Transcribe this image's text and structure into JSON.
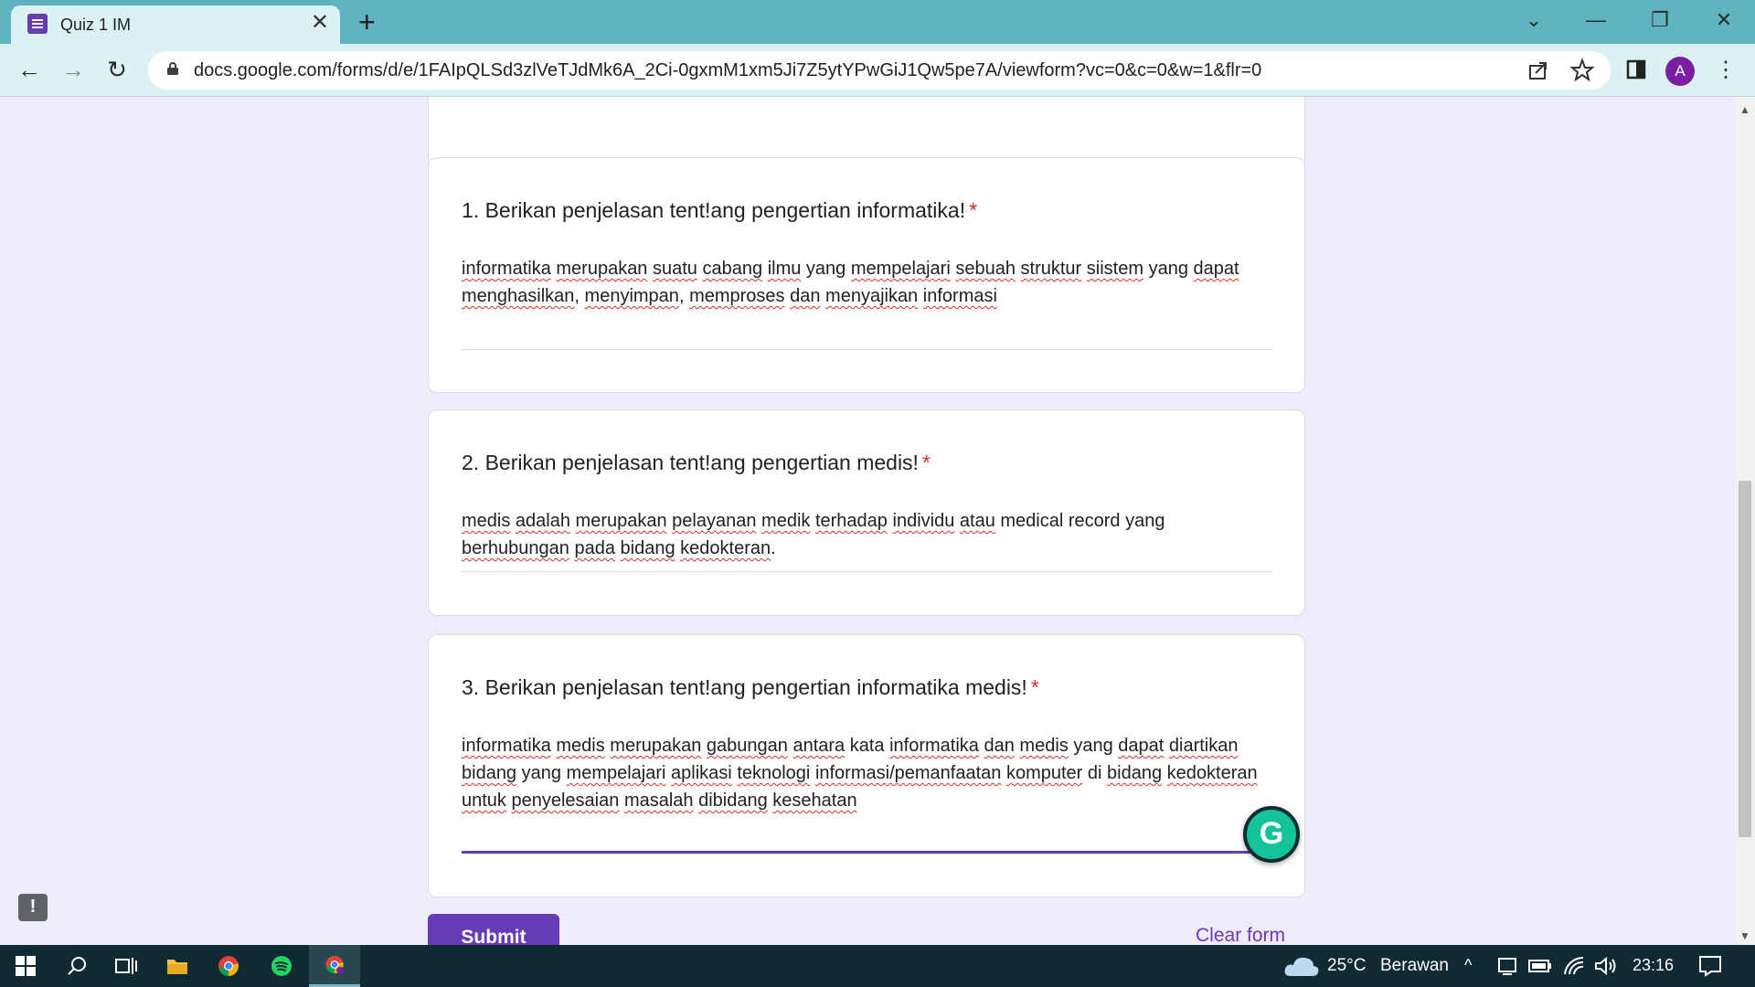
{
  "browser": {
    "tab": {
      "title": "Quiz 1 IM",
      "close": "✕"
    },
    "new_tab": "+",
    "window_controls": {
      "minimize": "—",
      "restore": "❐",
      "close": "✕",
      "tab_search": "⌄"
    },
    "nav": {
      "back": "←",
      "forward": "→",
      "reload": "↻"
    },
    "url": "docs.google.com/forms/d/e/1FAIpQLSd3zlVeTJdMk6A_2Ci-0gxmM1xm5Ji7Z5ytYPwGiJ1Qw5pe7A/viewform?vc=0&c=0&w=1&flr=0",
    "profile_initial": "A",
    "accent": "#5fb4bf"
  },
  "form": {
    "accent": "#673ab7",
    "required_mark": "*",
    "questions": [
      {
        "title": "1. Berikan penjelasan tent!ang pengertian informatika!",
        "answer": [
          [
            "informatika",
            true
          ],
          [
            " ",
            false
          ],
          [
            "merupakan",
            true
          ],
          [
            " ",
            false
          ],
          [
            "suatu",
            true
          ],
          [
            " ",
            false
          ],
          [
            "cabang",
            true
          ],
          [
            " ",
            false
          ],
          [
            "ilmu",
            true
          ],
          [
            " yang ",
            false
          ],
          [
            "mempelajari",
            true
          ],
          [
            " ",
            false
          ],
          [
            "sebuah",
            true
          ],
          [
            " ",
            false
          ],
          [
            "struktur",
            true
          ],
          [
            " ",
            false
          ],
          [
            "siistem",
            true
          ],
          [
            " yang ",
            false
          ],
          [
            "dapat",
            true
          ],
          [
            " ",
            false
          ],
          [
            "menghasilkan",
            true
          ],
          [
            ", ",
            false
          ],
          [
            "menyimpan",
            true
          ],
          [
            ", ",
            false
          ],
          [
            "memproses",
            true
          ],
          [
            " ",
            false
          ],
          [
            "dan",
            true
          ],
          [
            " ",
            false
          ],
          [
            "menyajikan",
            true
          ],
          [
            " ",
            false
          ],
          [
            "informasi",
            true
          ]
        ]
      },
      {
        "title": "2.  Berikan penjelasan tent!ang pengertian medis!",
        "answer": [
          [
            "medis",
            true
          ],
          [
            " ",
            false
          ],
          [
            "adalah",
            true
          ],
          [
            " ",
            false
          ],
          [
            "merupakan",
            true
          ],
          [
            " ",
            false
          ],
          [
            "pelayanan",
            true
          ],
          [
            " ",
            false
          ],
          [
            "medik",
            true
          ],
          [
            " ",
            false
          ],
          [
            "terhadap",
            true
          ],
          [
            " ",
            false
          ],
          [
            "individu",
            true
          ],
          [
            " ",
            false
          ],
          [
            "atau",
            true
          ],
          [
            " medical record yang ",
            false
          ],
          [
            "berhubungan",
            true
          ],
          [
            " ",
            false
          ],
          [
            "pada",
            true
          ],
          [
            " ",
            false
          ],
          [
            "bidang",
            true
          ],
          [
            " ",
            false
          ],
          [
            "kedokteran",
            true
          ],
          [
            ".",
            false
          ]
        ]
      },
      {
        "title": "3.   Berikan penjelasan tent!ang pengertian informatika medis!",
        "answer": [
          [
            "informatika",
            true
          ],
          [
            " ",
            false
          ],
          [
            "medis",
            true
          ],
          [
            " ",
            false
          ],
          [
            "merupakan",
            true
          ],
          [
            " ",
            false
          ],
          [
            "gabungan",
            true
          ],
          [
            " ",
            false
          ],
          [
            "antara",
            true
          ],
          [
            " kata ",
            false
          ],
          [
            "informatika",
            true
          ],
          [
            " ",
            false
          ],
          [
            "dan",
            true
          ],
          [
            " ",
            false
          ],
          [
            "medis",
            true
          ],
          [
            " yang ",
            false
          ],
          [
            "dapat",
            true
          ],
          [
            " ",
            false
          ],
          [
            "diartikan",
            true
          ],
          [
            " ",
            false
          ],
          [
            "bidang",
            true
          ],
          [
            " yang ",
            false
          ],
          [
            "mempelajari",
            true
          ],
          [
            " ",
            false
          ],
          [
            "aplikasi",
            true
          ],
          [
            " ",
            false
          ],
          [
            "teknologi",
            true
          ],
          [
            " ",
            false
          ],
          [
            "informasi/pemanfaatan",
            true
          ],
          [
            " ",
            false
          ],
          [
            "komputer",
            true
          ],
          [
            " di ",
            false
          ],
          [
            "bidang",
            true
          ],
          [
            " ",
            false
          ],
          [
            "kedokteran",
            true
          ],
          [
            " ",
            false
          ],
          [
            "untuk",
            true
          ],
          [
            " ",
            false
          ],
          [
            "penyelesaian",
            true
          ],
          [
            " ",
            false
          ],
          [
            "masalah",
            true
          ],
          [
            " ",
            false
          ],
          [
            "dibidang",
            true
          ],
          [
            " ",
            false
          ],
          [
            "kesehatan",
            true
          ]
        ]
      }
    ],
    "submit_label": "Submit",
    "clear_label": "Clear form",
    "feedback_icon": "!",
    "grammarly_letter": "G"
  },
  "taskbar": {
    "weather_temp": "25°C",
    "weather_text": "Berawan",
    "time": "23:16"
  }
}
